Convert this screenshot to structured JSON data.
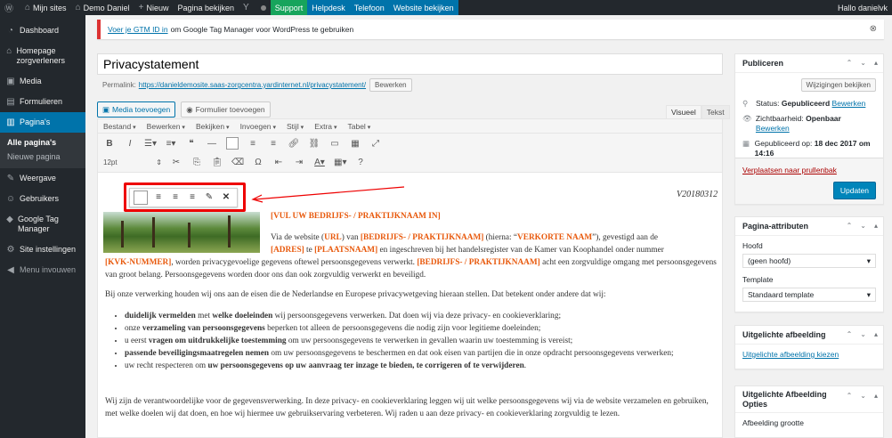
{
  "adminbar": {
    "my_sites": "Mijn sites",
    "site_name": "Demo Daniel",
    "new": "Nieuw",
    "view_page": "Pagina bekijken",
    "support": "Support",
    "helpdesk": "Helpdesk",
    "phone": "Telefoon",
    "view_website": "Website bekijken",
    "greeting": "Hallo danielvk"
  },
  "sidebar": {
    "items": [
      {
        "icon": "dashboard-icon",
        "label": "Dashboard"
      },
      {
        "icon": "home-icon",
        "label": "Homepage zorgverleners"
      },
      {
        "icon": "media-icon",
        "label": "Media"
      },
      {
        "icon": "forms-icon",
        "label": "Formulieren"
      },
      {
        "icon": "pages-icon",
        "label": "Pagina's"
      }
    ],
    "submenu": [
      "Alle pagina's",
      "Nieuwe pagina"
    ],
    "items2": [
      {
        "icon": "appearance-icon",
        "label": "Weergave"
      },
      {
        "icon": "users-icon",
        "label": "Gebruikers"
      },
      {
        "icon": "gtm-icon",
        "label": "Google Tag Manager"
      },
      {
        "icon": "settings-icon",
        "label": "Site instellingen"
      },
      {
        "icon": "collapse-icon",
        "label": "Menu invouwen"
      }
    ]
  },
  "notice": {
    "link": "Voer je GTM ID in",
    "text": "om Google Tag Manager voor WordPress te gebruiken"
  },
  "post": {
    "title": "Privacystatement",
    "permalink_label": "Permalink:",
    "permalink_url": "https://danieldemosite.saas-zorgcentra.yardinternet.nl/privacystatement/",
    "edit_button": "Bewerken"
  },
  "media": {
    "add_media": "Media toevoegen",
    "add_form": "Formulier toevoegen"
  },
  "tabs": {
    "visual": "Visueel",
    "text": "Tekst"
  },
  "editor_menu": [
    "Bestand",
    "Bewerken",
    "Bekijken",
    "Invoegen",
    "Stijl",
    "Extra",
    "Tabel"
  ],
  "font_size": "12pt",
  "content": {
    "version": "V20180312",
    "heading": "[VUL UW BEDRIJFS- / PRAKTIJKNAAM IN]",
    "p1": {
      "a": "Via de website (",
      "url": "URL",
      "b": ") van ",
      "name1": "[BEDRIJFS- / PRAKTIJKNAAM]",
      "c": " (hierna: “",
      "short": "VERKORTE NAAM",
      "d": "”), gevestigd aan de",
      "address": "[ADRES]",
      "e": " te ",
      "place": "[PLAATSNAAM]",
      "f": " en ingeschreven bij het handelsregister van de Kamer van Koophandel onder nummer",
      "kvk": "[KVK-NUMMER]",
      "g": ", worden privacygevoelige gegevens oftewel persoonsgegevens verwerkt. ",
      "name2": "[BEDRIJFS- / PRAKTIJKNAAM]",
      "h": " acht een zorgvuldige omgang met persoonsgegevens van groot belang. Persoonsgegevens worden door ons dan ook zorgvuldig verwerkt en beveiligd."
    },
    "p2": "Bij onze verwerking houden wij ons aan de eisen die de Nederlandse en Europese privacywetgeving hieraan stellen. Dat betekent onder andere dat wij:",
    "bullets": [
      {
        "pre": "",
        "b1": "duidelijk vermelden",
        "mid": " met ",
        "b2": "welke doeleinden",
        "post": " wij persoonsgegevens verwerken. Dat doen wij via deze privacy- en cookieverklaring;"
      },
      {
        "pre": "onze ",
        "b1": "verzameling van persoonsgegevens",
        "mid": "",
        "b2": "",
        "post": " beperken tot alleen de persoonsgegevens die nodig zijn voor legitieme doeleinden;"
      },
      {
        "pre": "u eerst ",
        "b1": "vragen om uitdrukkelijke toestemming",
        "mid": "",
        "b2": "",
        "post": " om uw persoonsgegevens te verwerken in gevallen waarin uw toestemming is vereist;"
      },
      {
        "pre": "",
        "b1": "passende beveiligingsmaatregelen nemen",
        "mid": "",
        "b2": "",
        "post": " om uw persoonsgegevens te beschermen en dat ook eisen van partijen die in onze opdracht persoonsgegevens verwerken;"
      },
      {
        "pre": "uw recht respecteren om ",
        "b1": "uw persoonsgegevens op uw aanvraag ter inzage te bieden, te corrigeren of te verwijderen",
        "mid": "",
        "b2": "",
        "post": "."
      }
    ],
    "p3": "Wij zijn de verantwoordelijke voor de gegevensverwerking. In deze privacy- en cookieverklaring leggen wij uit welke persoonsgegevens wij via de website verzamelen en gebruiken, met welke doelen wij dat doen, en hoe wij hiermee uw gebruikservaring verbeteren. Wij raden u aan deze privacy- en cookieverklaring zorgvuldig te lezen."
  },
  "publish": {
    "title": "Publiceren",
    "view_changes": "Wijzigingen bekijken",
    "status_label": "Status:",
    "status_value": "Gepubliceerd",
    "visibility_label": "Zichtbaarheid:",
    "visibility_value": "Openbaar",
    "published_label": "Gepubliceerd op:",
    "published_value": "18 dec 2017 om 14:16",
    "edit": "Bewerken",
    "trash": "Verplaatsen naar prullenbak",
    "update": "Updaten"
  },
  "page_attributes": {
    "title": "Pagina-attributen",
    "parent_label": "Hoofd",
    "parent_value": "(geen hoofd)",
    "template_label": "Template",
    "template_value": "Standaard template"
  },
  "featured": {
    "title": "Uitgelichte afbeelding",
    "link": "Uitgelichte afbeelding kiezen"
  },
  "featured_options": {
    "title": "Uitgelichte Afbeelding Opties",
    "size_label": "Afbeelding grootte"
  }
}
